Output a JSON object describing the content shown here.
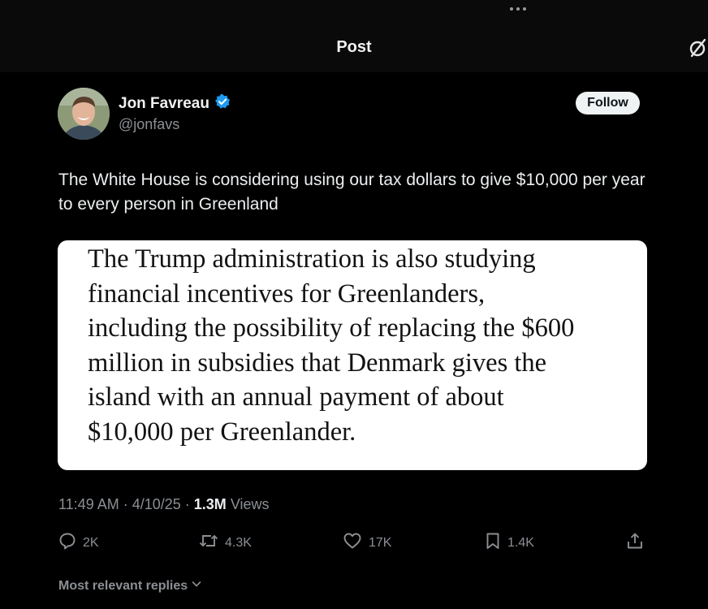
{
  "header": {
    "title": "Post",
    "more_icon": "more-dots-icon",
    "right_icon": "no-signal-icon"
  },
  "author": {
    "name": "Jon Favreau",
    "handle": "@jonfavs",
    "verified": true,
    "verified_color": "#1d9bf0",
    "follow_label": "Follow"
  },
  "tweet": {
    "text": "The White House is considering using our tax dollars to give $10,000 per year to every person in Greenland"
  },
  "quote_image": {
    "lines": [
      "The Trump administration is also studying",
      "financial incentives for Greenlanders,",
      "including the possibility of replacing the $600",
      "million in subsidies that Denmark gives the",
      "island with an annual payment of about",
      "$10,000 per Greenlander."
    ]
  },
  "meta": {
    "time": "11:49 AM",
    "sep1": " · ",
    "date": "4/10/25",
    "sep2": " · ",
    "views_count": "1.3M",
    "views_label": " Views"
  },
  "actions": {
    "replies": "2K",
    "reposts": "4.3K",
    "likes": "17K",
    "bookmarks": "1.4K"
  },
  "replies_filter": {
    "label": "Most relevant replies"
  }
}
